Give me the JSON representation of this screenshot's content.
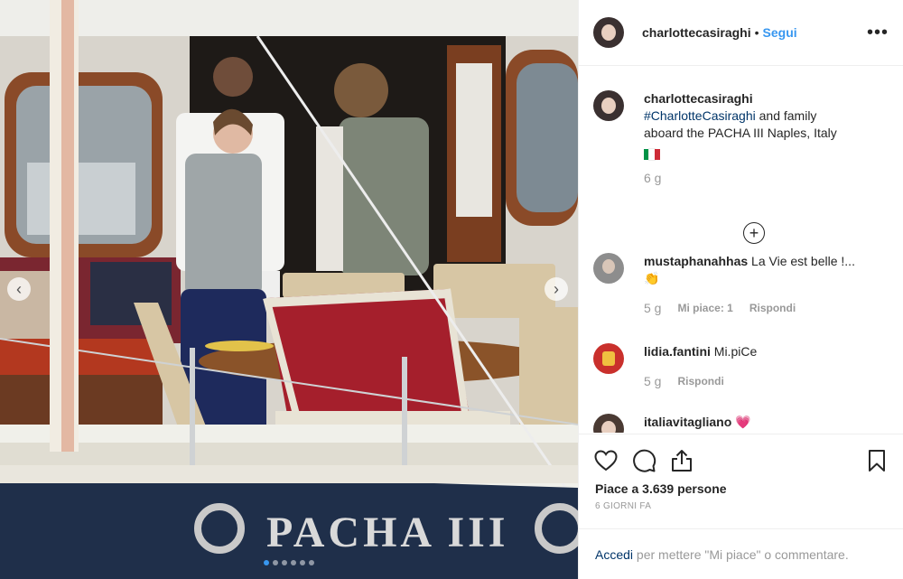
{
  "post": {
    "username": "charlottecasiraghi",
    "separator": "•",
    "follow_label": "Segui",
    "more_label": "•••"
  },
  "caption": {
    "username": "charlottecasiraghi",
    "hashtag": "#CharlotteCasiraghi",
    "text_line1": " and family",
    "text_line2": "aboard the PACHA III Naples, Italy",
    "flag_colors": [
      "#009246",
      "#ffffff",
      "#ce2b37"
    ],
    "time": "6 g",
    "load_more_label": "+"
  },
  "comments": [
    {
      "username": "mustaphanahhas",
      "text": "La Vie est belle !...",
      "emoji": "👏",
      "time": "5 g",
      "likes": "Mi piace: 1",
      "reply": "Rispondi"
    },
    {
      "username": "lidia.fantini",
      "text": "Mi.piCe",
      "time": "5 g",
      "reply": "Rispondi"
    },
    {
      "username": "italiavitagliano",
      "text": "💗"
    }
  ],
  "actions": {
    "like_icon": "heart-icon",
    "comment_icon": "comment-icon",
    "share_icon": "share-icon",
    "save_icon": "bookmark-icon",
    "likes_text": "Piace a 3.639 persone",
    "time_ago": "6 GIORNI FA"
  },
  "login_bar": {
    "link": "Accedi",
    "text": " per mettere \"Mi piace\" o commentare."
  },
  "photo": {
    "boat_name": "PACHA III",
    "nav_prev": "‹",
    "nav_next": "›",
    "accent_color": "#3897f0"
  }
}
